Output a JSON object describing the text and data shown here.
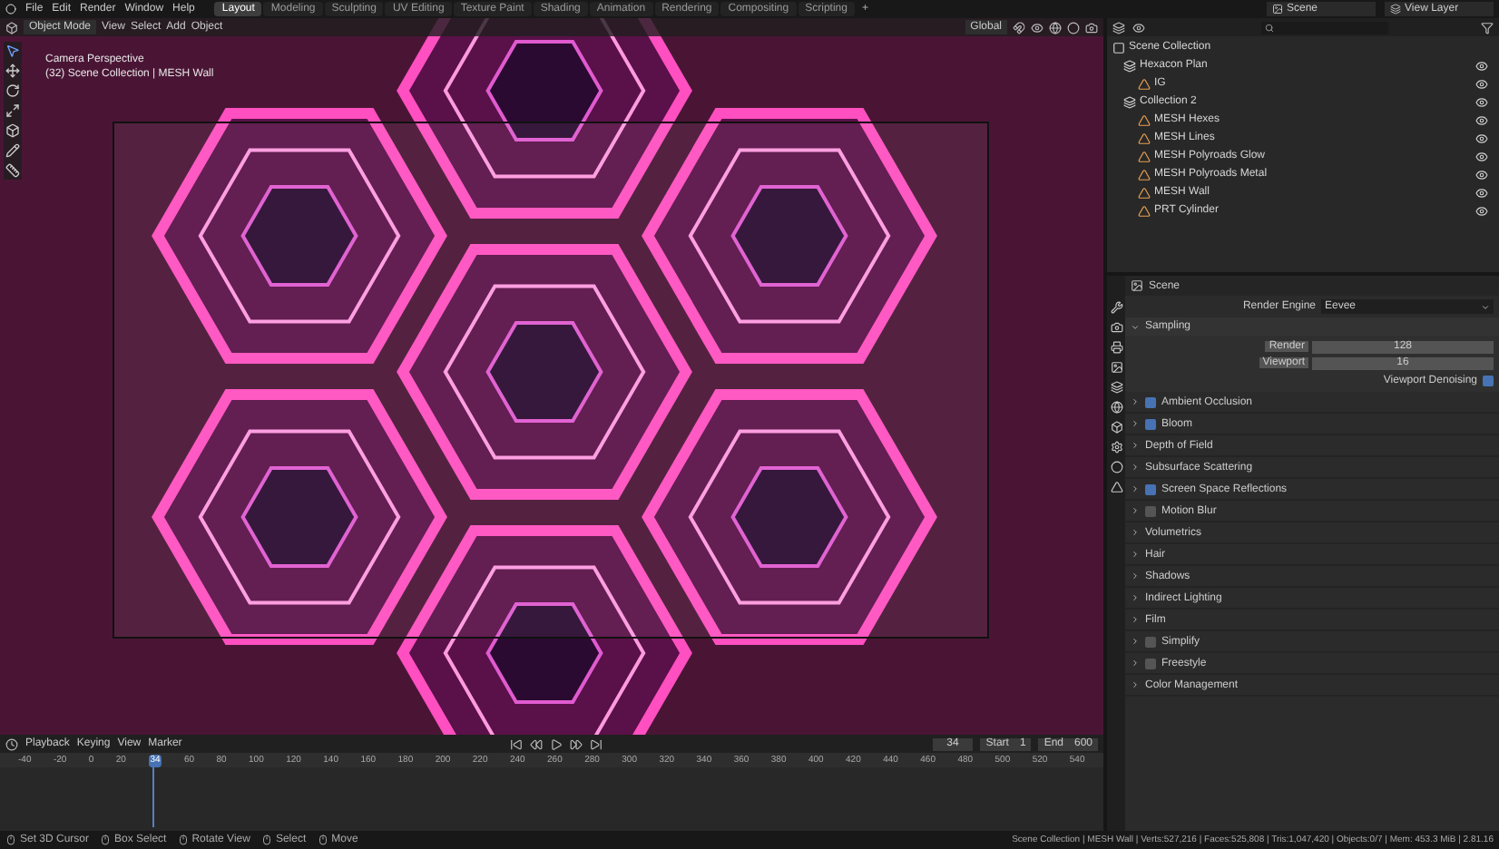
{
  "menu": [
    "File",
    "Edit",
    "Render",
    "Window",
    "Help"
  ],
  "workspaces": [
    {
      "label": "Layout",
      "selected": true
    },
    {
      "label": "Modeling",
      "selected": false
    },
    {
      "label": "Sculpting",
      "selected": false
    },
    {
      "label": "UV Editing",
      "selected": false
    },
    {
      "label": "Texture Paint",
      "selected": false
    },
    {
      "label": "Shading",
      "selected": false
    },
    {
      "label": "Animation",
      "selected": false
    },
    {
      "label": "Rendering",
      "selected": false
    },
    {
      "label": "Compositing",
      "selected": false
    },
    {
      "label": "Scripting",
      "selected": false
    }
  ],
  "add_tab": "+",
  "scene": "Scene",
  "view_layer": "View Layer",
  "viewport": {
    "mode": "Object Mode",
    "menus": [
      "View",
      "Select",
      "Add",
      "Object"
    ],
    "orientation": "Global",
    "overlay_title": "Camera Perspective",
    "overlay_subtitle": "(32) Scene Collection | MESH Wall"
  },
  "outliner": {
    "root": "Scene Collection",
    "children": [
      {
        "name": "Hexacon Plan",
        "kind": "collection",
        "children": [
          {
            "name": "IG",
            "kind": "object"
          }
        ]
      },
      {
        "name": "Collection 2",
        "kind": "collection",
        "children": [
          {
            "name": "MESH Hexes",
            "kind": "object"
          },
          {
            "name": "MESH Lines",
            "kind": "object"
          },
          {
            "name": "MESH Polyroads Glow",
            "kind": "object"
          },
          {
            "name": "MESH Polyroads Metal",
            "kind": "object"
          },
          {
            "name": "MESH Wall",
            "kind": "object"
          },
          {
            "name": "PRT Cylinder",
            "kind": "object"
          }
        ]
      }
    ]
  },
  "properties": {
    "context": "Scene",
    "render_engine_label": "Render Engine",
    "render_engine": "Eevee",
    "sampling": {
      "title": "Sampling",
      "expanded": true,
      "render_label": "Render",
      "render": "128",
      "viewport_label": "Viewport",
      "viewport": "16",
      "denoise_label": "Viewport Denoising",
      "denoise": true
    },
    "panels": [
      {
        "label": "Ambient Occlusion",
        "kind": "checkbox",
        "checked": true
      },
      {
        "label": "Bloom",
        "kind": "checkbox",
        "checked": true
      },
      {
        "label": "Depth of Field",
        "kind": "plain"
      },
      {
        "label": "Subsurface Scattering",
        "kind": "plain"
      },
      {
        "label": "Screen Space Reflections",
        "kind": "checkbox",
        "checked": true
      },
      {
        "label": "Motion Blur",
        "kind": "checkbox",
        "checked": false
      },
      {
        "label": "Volumetrics",
        "kind": "plain"
      },
      {
        "label": "Hair",
        "kind": "plain"
      },
      {
        "label": "Shadows",
        "kind": "plain"
      },
      {
        "label": "Indirect Lighting",
        "kind": "plain"
      },
      {
        "label": "Film",
        "kind": "plain"
      },
      {
        "label": "Simplify",
        "kind": "checkbox",
        "checked": false
      },
      {
        "label": "Freestyle",
        "kind": "checkbox",
        "checked": false
      },
      {
        "label": "Color Management",
        "kind": "plain"
      }
    ]
  },
  "timeline": {
    "menus": [
      "Playback",
      "Keying",
      "View",
      "Marker"
    ],
    "frame_field": "34",
    "start_label": "Start",
    "start": "1",
    "end_label": "End",
    "end": "600",
    "ruler": [
      {
        "kind": "tick",
        "label": "-40"
      },
      {
        "kind": "tick",
        "label": "-20"
      },
      {
        "kind": "tick",
        "label": "0"
      },
      {
        "kind": "tick",
        "label": "20"
      },
      {
        "kind": "current",
        "label": "34"
      },
      {
        "kind": "tick",
        "label": "60"
      },
      {
        "kind": "tick",
        "label": "80"
      },
      {
        "kind": "tick",
        "label": "100"
      },
      {
        "kind": "tick",
        "label": "120"
      },
      {
        "kind": "tick",
        "label": "140"
      },
      {
        "kind": "tick",
        "label": "160"
      },
      {
        "kind": "tick",
        "label": "180"
      },
      {
        "kind": "tick",
        "label": "200"
      },
      {
        "kind": "tick",
        "label": "220"
      },
      {
        "kind": "tick",
        "label": "240"
      },
      {
        "kind": "tick",
        "label": "260"
      },
      {
        "kind": "tick",
        "label": "280"
      },
      {
        "kind": "tick",
        "label": "300"
      },
      {
        "kind": "tick",
        "label": "320"
      },
      {
        "kind": "tick",
        "label": "340"
      },
      {
        "kind": "tick",
        "label": "360"
      },
      {
        "kind": "tick",
        "label": "380"
      },
      {
        "kind": "tick",
        "label": "400"
      },
      {
        "kind": "tick",
        "label": "420"
      },
      {
        "kind": "tick",
        "label": "440"
      },
      {
        "kind": "tick",
        "label": "460"
      },
      {
        "kind": "tick",
        "label": "480"
      },
      {
        "kind": "tick",
        "label": "500"
      },
      {
        "kind": "tick",
        "label": "520"
      },
      {
        "kind": "tick",
        "label": "540"
      }
    ]
  },
  "status_bar": {
    "hints": [
      "Set 3D Cursor",
      "Box Select",
      "Rotate View",
      "Select",
      "Move"
    ],
    "stats": "Scene Collection | MESH Wall | Verts:527,216 | Faces:525,808 | Tris:1,047,420 | Objects:0/7 | Mem: 453.3 MiB | 2.81.16"
  }
}
